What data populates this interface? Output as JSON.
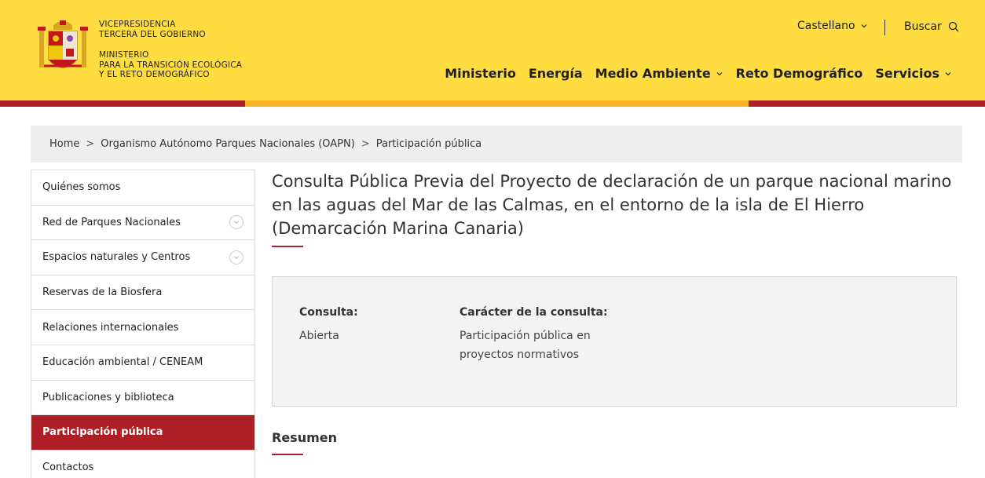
{
  "header": {
    "org_lines_1": [
      "Vicepresidencia",
      "Tercera del Gobierno"
    ],
    "org_lines_2": [
      "Ministerio",
      "para la Transición Ecológica",
      "y el Reto Demográfico"
    ],
    "language": "Castellano",
    "search_label": "Buscar",
    "nav": [
      "Ministerio",
      "Energía",
      "Medio Ambiente",
      "Reto Demográfico",
      "Servicios"
    ]
  },
  "breadcrumb": [
    "Home",
    "Organismo Autónomo Parques Nacionales (OAPN)",
    "Participación pública"
  ],
  "sidebar": {
    "items": [
      "Quiénes somos",
      "Red de Parques Nacionales",
      "Espacios naturales y Centros",
      "Reservas de la Biosfera",
      "Relaciones internacionales",
      "Educación ambiental / CENEAM",
      "Publicaciones y biblioteca",
      "Participación pública",
      "Contactos"
    ]
  },
  "main": {
    "title": "Consulta Pública Previa del Proyecto de declaración de un parque nacional marino en las aguas del Mar de las Calmas, en el entorno de la isla de El Hierro (Demarcación Marina Canaria)",
    "info": {
      "consulta_label": "Consulta:",
      "consulta_value": "Abierta",
      "caracter_label": "Carácter de la consulta:",
      "caracter_value_1": "Participación pública en",
      "caracter_value_2": "proyectos normativos"
    },
    "resumen": "Resumen"
  },
  "colors": {
    "header_bg": "#ffdc3f",
    "accent_red": "#ad1f26",
    "accent_orange": "#f9b526"
  }
}
